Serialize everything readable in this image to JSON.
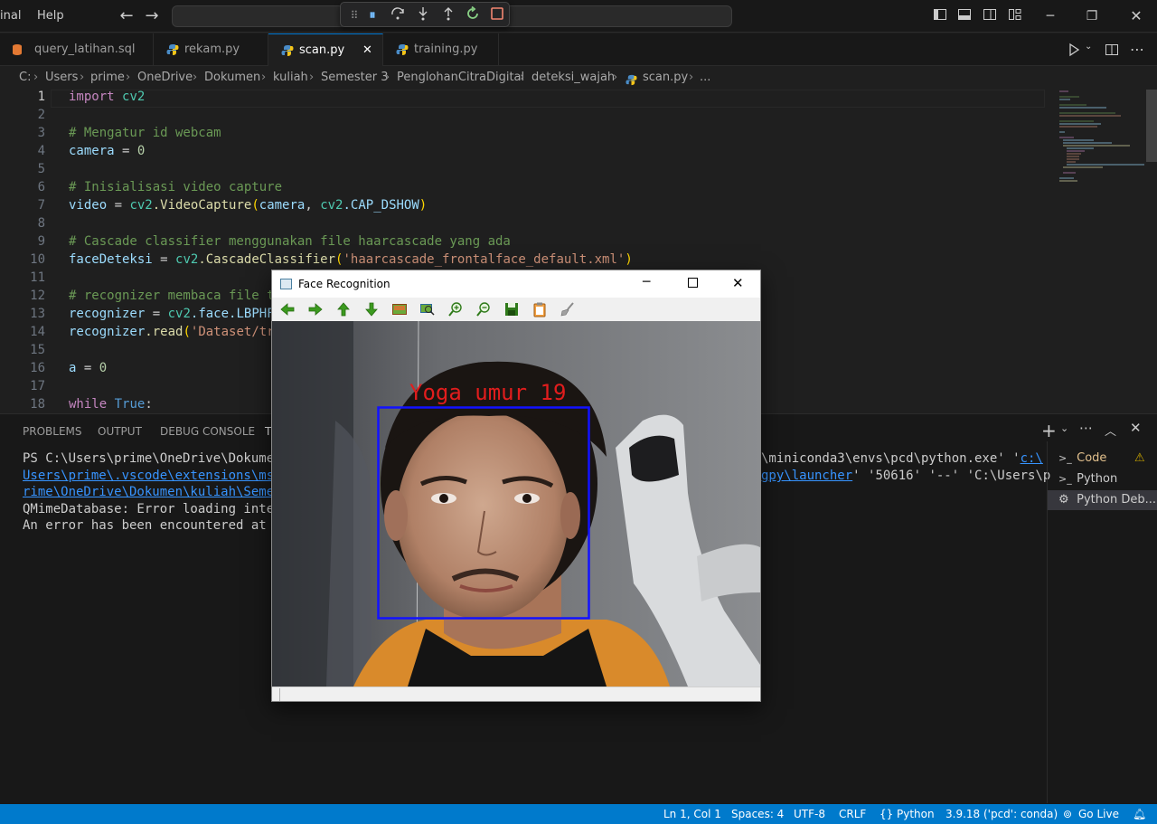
{
  "menu": {
    "terminal": "inal",
    "help": "Help"
  },
  "tabs": [
    {
      "label": "query_latihan.sql"
    },
    {
      "label": "rekam.py"
    },
    {
      "label": "scan.py"
    },
    {
      "label": "training.py"
    }
  ],
  "breadcrumb": [
    "C:",
    "Users",
    "prime",
    "OneDrive",
    "Dokumen",
    "kuliah",
    "Semester 3",
    "PenglohanCitraDigital",
    "deteksi_wajah",
    "scan.py",
    "..."
  ],
  "code": {
    "line_numbers": [
      "1",
      "2",
      "3",
      "4",
      "5",
      "6",
      "7",
      "8",
      "9",
      "10",
      "11",
      "12",
      "13",
      "14",
      "15",
      "16",
      "17",
      "18"
    ],
    "l1_kw": "import",
    "l1_mod": "cv2",
    "l3": "# Mengatur id webcam",
    "l4_var": "camera",
    "l4_op": " = ",
    "l4_val": "0",
    "l6": "# Inisialisasi video capture",
    "l7_var": "video",
    "l7_eq": " = ",
    "l7_mod": "cv2",
    "l7_fn": ".VideoCapture",
    "l7_open": "(",
    "l7_arg1": "camera",
    "l7_comma": ", ",
    "l7_mod2": "cv2",
    "l7_const": ".CAP_DSHOW",
    "l7_close": ")",
    "l9": "# Cascade classifier menggunakan file haarcascade yang ada",
    "l10_var": "faceDeteksi",
    "l10_eq": " = ",
    "l10_mod": "cv2",
    "l10_fn": ".CascadeClassifier",
    "l10_open": "(",
    "l10_str": "'haarcascade_frontalface_default.xml'",
    "l10_close": ")",
    "l12": "# recognizer membaca file tr",
    "l13_var": "recognizer",
    "l13_eq": " = ",
    "l13_mod": "cv2",
    "l13_rest": ".face.LBPHFa",
    "l14_var": "recognizer",
    "l14_fn": ".read",
    "l14_open": "(",
    "l14_str": "'Dataset/tra",
    "l16_var": "a",
    "l16_eq": " = ",
    "l16_val": "0",
    "l18_kw": "while",
    "l18_val": " True",
    "l18_colon": ":"
  },
  "panel": {
    "tabs": [
      "PROBLEMS",
      "OUTPUT",
      "DEBUG CONSOLE",
      "TI"
    ],
    "terminal_lines": {
      "line1_left": "PS C:\\Users\\prime\\OneDrive\\Dokumen\\k",
      "line1_right_a": "\\miniconda3\\envs\\pcd\\python.exe' '",
      "line1_right_link": "c:\\",
      "line2_left": "Users\\prime\\.vscode\\extensions\\ms-py",
      "line2_right_link": "gpy\\launcher",
      "line2_right_b": "' '50616' '--' 'C:\\Users\\p",
      "line3_left": "rime\\OneDrive\\Dokumen\\kuliah\\Semeste",
      "line4": "QMimeDatabase: Error loading interna",
      "line5": "An error has been encountered at lin"
    },
    "terminals": [
      {
        "label": "Code",
        "warn": "⚠"
      },
      {
        "label": "Python"
      },
      {
        "label": "Python Deb..."
      }
    ]
  },
  "face_window": {
    "title": "Face Recognition",
    "label": "Yoga umur 19",
    "label_color": "#e11d1d",
    "box_color": "#1212ff"
  },
  "status": {
    "position": "Ln 1, Col 1",
    "spaces": "Spaces: 4",
    "encoding": "UTF-8",
    "eol": "CRLF",
    "language": "Python",
    "interpreter": "3.9.18 ('pcd': conda)",
    "golive": "Go Live"
  },
  "colors": {
    "accent": "#0078d4",
    "statusbar": "#007acc"
  }
}
